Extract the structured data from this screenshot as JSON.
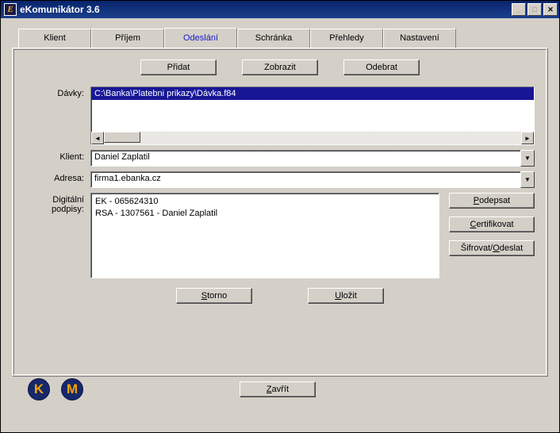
{
  "window": {
    "title": "eKomunikátor 3.6"
  },
  "tabs": {
    "klient": "Klient",
    "prijem": "Příjem",
    "odeslani": "Odeslání",
    "schranka": "Schránka",
    "prehledy": "Přehledy",
    "nastaveni": "Nastavení"
  },
  "buttons": {
    "pridat": "Přidat",
    "zobrazit": "Zobrazit",
    "odebrat": "Odebrat",
    "podepsat": "Podepsat",
    "certifikovat": "Certifikovat",
    "sifrovat_odeslat": "Šifrovat/Odeslat",
    "storno": "Storno",
    "ulozit": "Uložit",
    "zavrit": "Zavřít"
  },
  "labels": {
    "davky": "Dávky:",
    "klient": "Klient:",
    "adresa": "Adresa:",
    "digipodpisy_l1": "Digitální",
    "digipodpisy_l2": "podpisy:"
  },
  "values": {
    "davky_item": "C:\\Banka\\Platebni prikazy\\Dávka.f84",
    "klient": "Daniel Zaplatil",
    "adresa": "firma1.ebanka.cz",
    "sig1": "EK - 065624310",
    "sig2": "RSA - 1307561 - Daniel Zaplatil"
  },
  "icons": {
    "k": "K",
    "m": "M",
    "app": "E"
  }
}
